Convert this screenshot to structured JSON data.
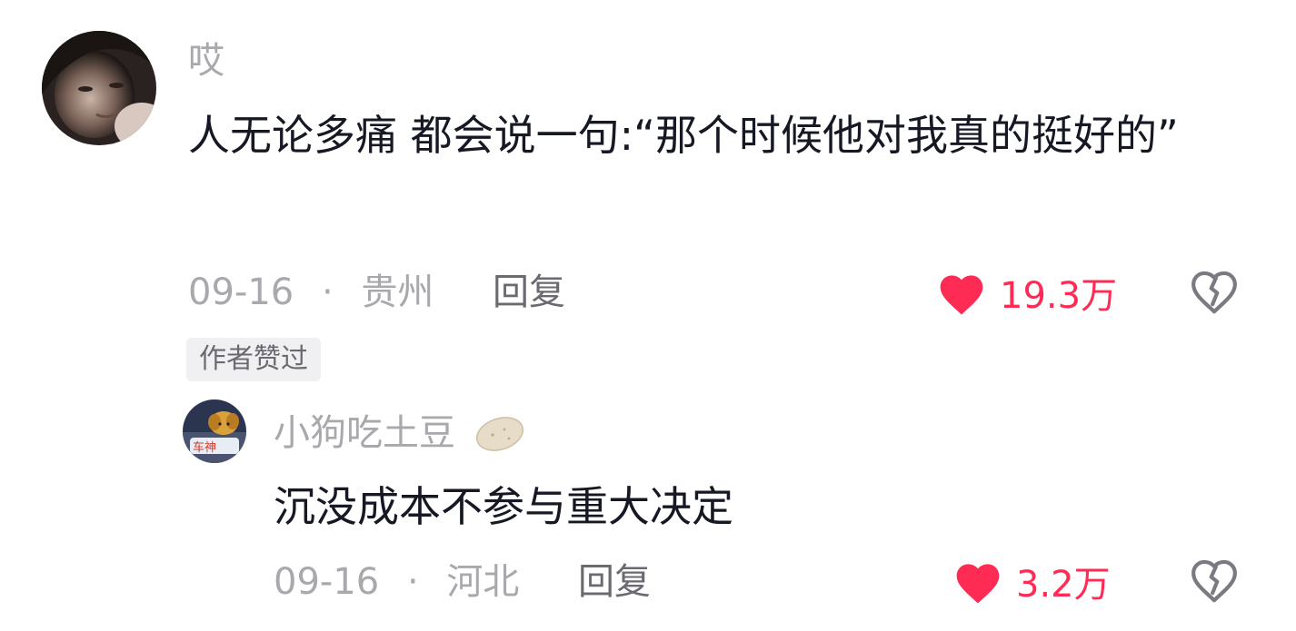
{
  "comment": {
    "username": "哎",
    "text": "人无论多痛 都会说一句:“那个时候他对我真的挺好的”",
    "date": "09-16",
    "separator": "·",
    "location": "贵州",
    "reply_label": "回复",
    "likes": "19.3万",
    "author_badge": "作者赞过"
  },
  "reply": {
    "username": "小狗吃土豆",
    "username_emoji": "potato-icon",
    "text": "沉没成本不参与重大决定",
    "date": "09-16",
    "separator": "·",
    "location": "河北",
    "reply_label": "回复",
    "likes": "3.2万"
  },
  "colors": {
    "like": "#fe2c55",
    "text": "#161823",
    "muted": "#a8a8ad",
    "reply": "#6a6a70"
  }
}
